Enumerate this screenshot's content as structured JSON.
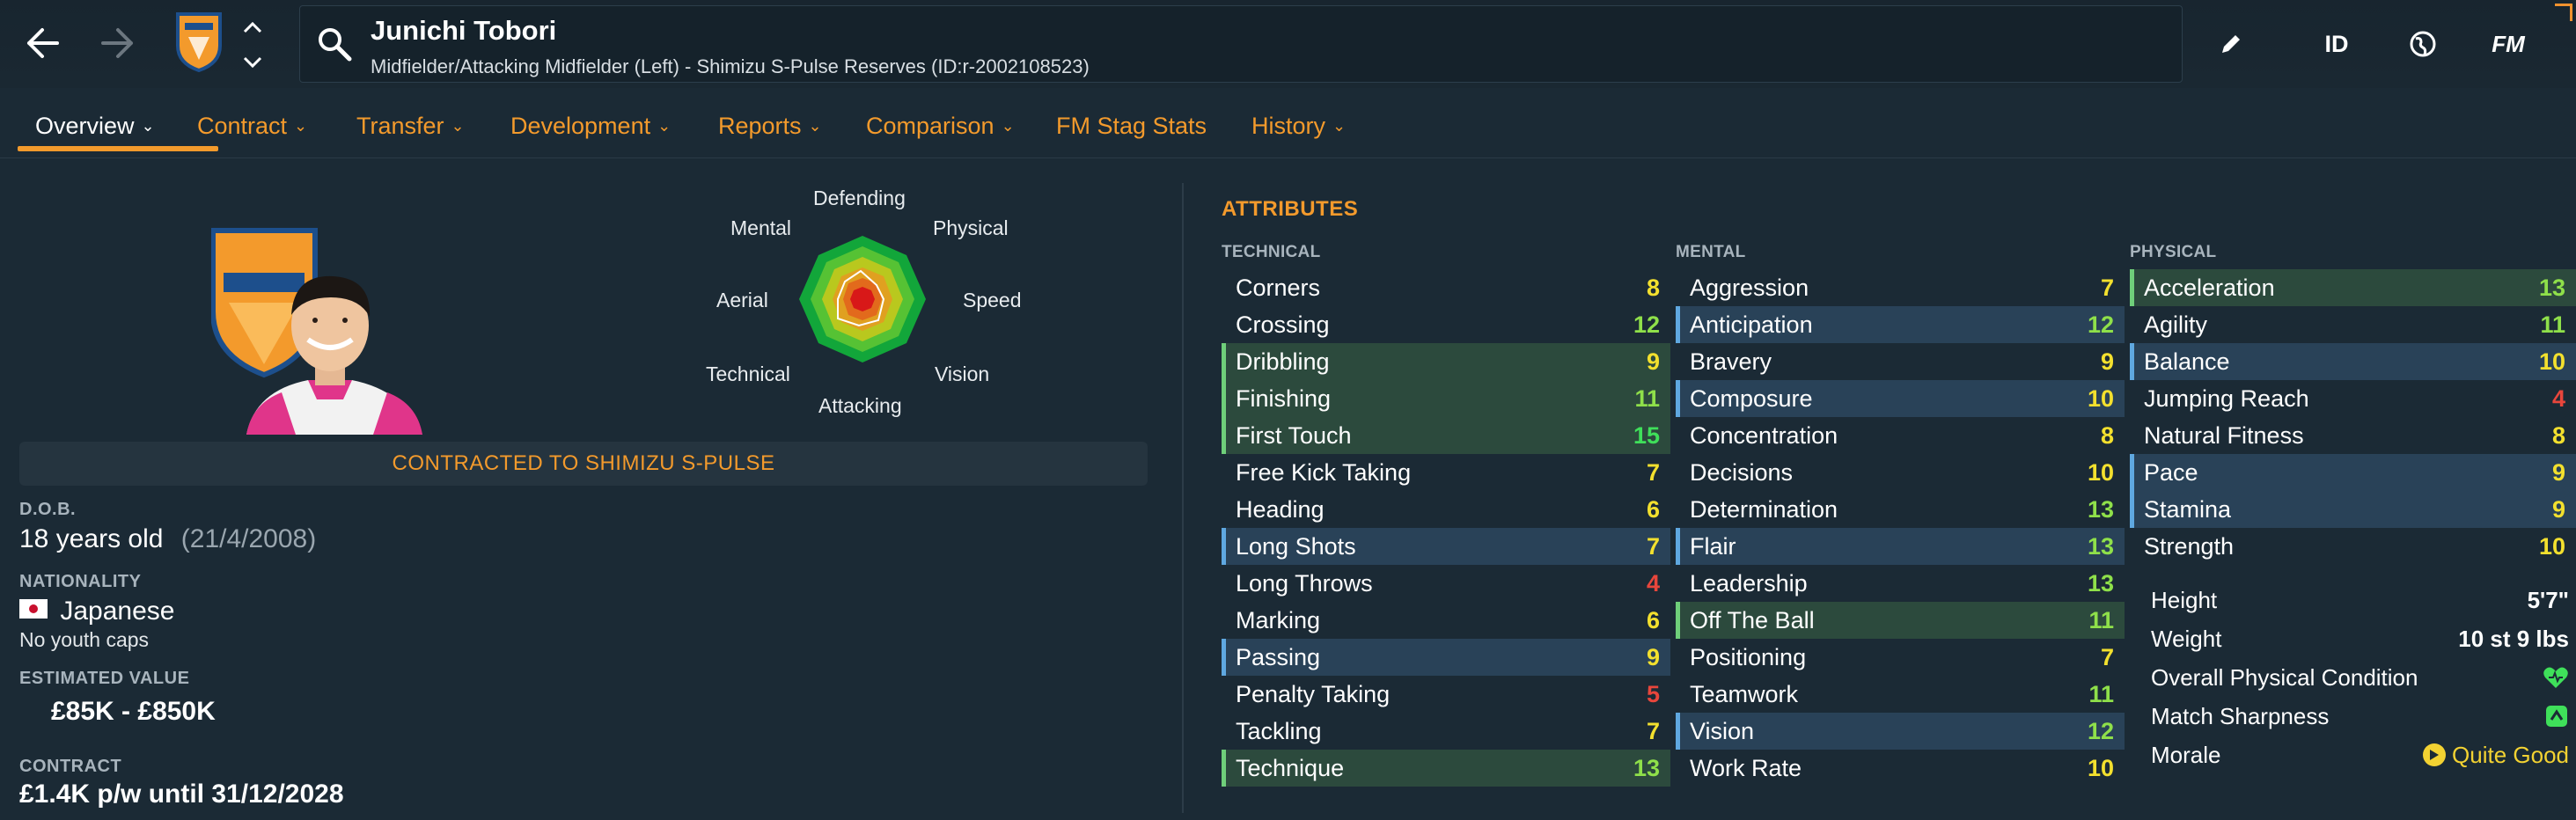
{
  "header": {
    "player_name": "Junichi Tobori",
    "subtitle": "Midfielder/Attacking Midfielder (Left) - Shimizu S-Pulse Reserves (ID:r-2002108523)",
    "id_label": "ID",
    "fm_label": "FM"
  },
  "tabs": [
    {
      "label": "Overview",
      "has_menu": true,
      "active": true
    },
    {
      "label": "Contract",
      "has_menu": true
    },
    {
      "label": "Transfer",
      "has_menu": true
    },
    {
      "label": "Development",
      "has_menu": true
    },
    {
      "label": "Reports",
      "has_menu": true
    },
    {
      "label": "Comparison",
      "has_menu": true
    },
    {
      "label": "FM Stag Stats",
      "has_menu": false
    },
    {
      "label": "History",
      "has_menu": true
    }
  ],
  "radar": {
    "labels": {
      "defending": "Defending",
      "physical": "Physical",
      "speed": "Speed",
      "vision": "Vision",
      "attacking": "Attacking",
      "technical": "Technical",
      "aerial": "Aerial",
      "mental": "Mental"
    }
  },
  "overview": {
    "contract_banner": "CONTRACTED TO SHIMIZU S-PULSE",
    "dob_label": "D.O.B.",
    "age": "18 years old",
    "dob": "(21/4/2008)",
    "nationality_label": "NATIONALITY",
    "nationality": "Japanese",
    "youth_caps": "No youth caps",
    "value_label": "ESTIMATED VALUE",
    "value": "£85K - £850K",
    "contract_label": "CONTRACT",
    "contract": "£1.4K p/w until 31/12/2028"
  },
  "attributes": {
    "title": "ATTRIBUTES",
    "technical": {
      "heading": "TECHNICAL",
      "items": [
        {
          "name": "Corners",
          "value": "8",
          "hl": ""
        },
        {
          "name": "Crossing",
          "value": "12",
          "hl": ""
        },
        {
          "name": "Dribbling",
          "value": "9",
          "hl": "green"
        },
        {
          "name": "Finishing",
          "value": "11",
          "hl": "green"
        },
        {
          "name": "First Touch",
          "value": "15",
          "hl": "green"
        },
        {
          "name": "Free Kick Taking",
          "value": "7",
          "hl": ""
        },
        {
          "name": "Heading",
          "value": "6",
          "hl": ""
        },
        {
          "name": "Long Shots",
          "value": "7",
          "hl": "blue"
        },
        {
          "name": "Long Throws",
          "value": "4",
          "hl": ""
        },
        {
          "name": "Marking",
          "value": "6",
          "hl": ""
        },
        {
          "name": "Passing",
          "value": "9",
          "hl": "blue"
        },
        {
          "name": "Penalty Taking",
          "value": "5",
          "hl": ""
        },
        {
          "name": "Tackling",
          "value": "7",
          "hl": ""
        },
        {
          "name": "Technique",
          "value": "13",
          "hl": "green"
        }
      ]
    },
    "mental": {
      "heading": "MENTAL",
      "items": [
        {
          "name": "Aggression",
          "value": "7",
          "hl": ""
        },
        {
          "name": "Anticipation",
          "value": "12",
          "hl": "blue"
        },
        {
          "name": "Bravery",
          "value": "9",
          "hl": ""
        },
        {
          "name": "Composure",
          "value": "10",
          "hl": "blue"
        },
        {
          "name": "Concentration",
          "value": "8",
          "hl": ""
        },
        {
          "name": "Decisions",
          "value": "10",
          "hl": ""
        },
        {
          "name": "Determination",
          "value": "13",
          "hl": ""
        },
        {
          "name": "Flair",
          "value": "13",
          "hl": "blue"
        },
        {
          "name": "Leadership",
          "value": "13",
          "hl": ""
        },
        {
          "name": "Off The Ball",
          "value": "11",
          "hl": "green"
        },
        {
          "name": "Positioning",
          "value": "7",
          "hl": ""
        },
        {
          "name": "Teamwork",
          "value": "11",
          "hl": ""
        },
        {
          "name": "Vision",
          "value": "12",
          "hl": "blue"
        },
        {
          "name": "Work Rate",
          "value": "10",
          "hl": ""
        }
      ]
    },
    "physical": {
      "heading": "PHYSICAL",
      "items": [
        {
          "name": "Acceleration",
          "value": "13",
          "hl": "green"
        },
        {
          "name": "Agility",
          "value": "11",
          "hl": ""
        },
        {
          "name": "Balance",
          "value": "10",
          "hl": "blue"
        },
        {
          "name": "Jumping Reach",
          "value": "4",
          "hl": ""
        },
        {
          "name": "Natural Fitness",
          "value": "8",
          "hl": ""
        },
        {
          "name": "Pace",
          "value": "9",
          "hl": "blue"
        },
        {
          "name": "Stamina",
          "value": "9",
          "hl": "blue"
        },
        {
          "name": "Strength",
          "value": "10",
          "hl": ""
        }
      ]
    }
  },
  "physical_info": {
    "height_label": "Height",
    "height": "5'7\"",
    "weight_label": "Weight",
    "weight": "10 st 9 lbs",
    "condition_label": "Overall Physical Condition",
    "sharpness_label": "Match Sharpness",
    "morale_label": "Morale",
    "morale": "Quite Good"
  },
  "colors": {
    "accent": "#f39a2c",
    "value_red": "#e8463c",
    "value_orange": "#f0a030",
    "value_yellow": "#f3e02e",
    "value_green": "#8fe04a",
    "value_bright_green": "#3fe05a"
  }
}
